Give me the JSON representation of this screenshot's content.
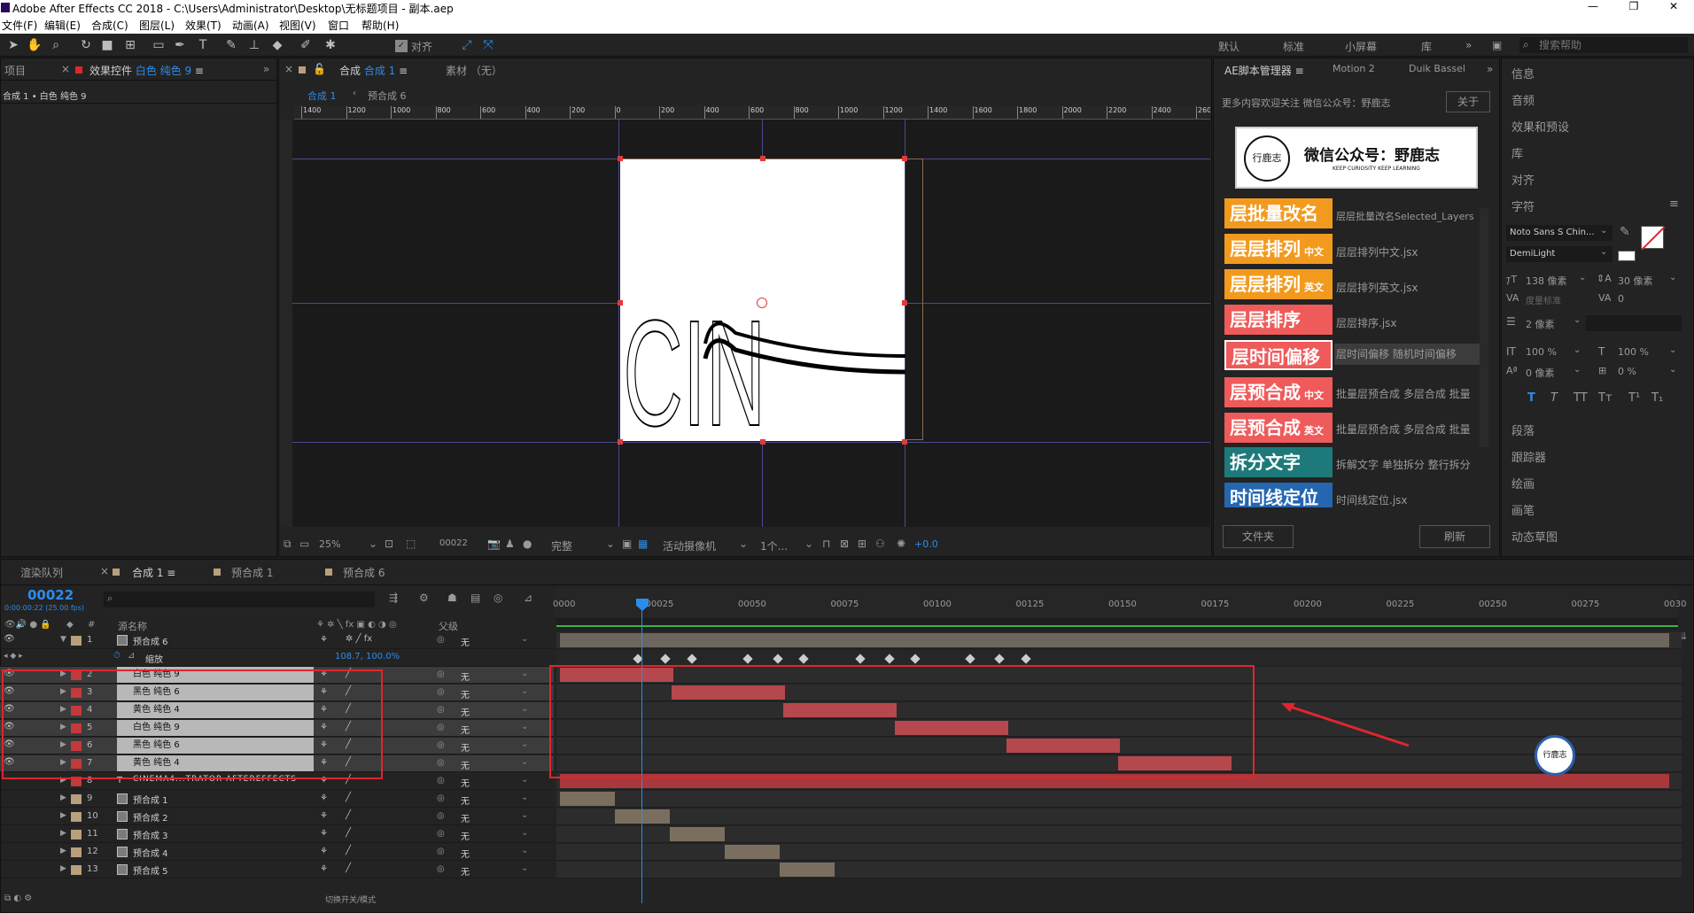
{
  "titlebar": {
    "title": "Adobe After Effects CC 2018 - C:\\Users\\Administrator\\Desktop\\无标题项目 - 副本.aep",
    "minimize": "—",
    "restore": "❐",
    "close": "✕"
  },
  "menu": [
    "文件(F)",
    "编辑(E)",
    "合成(C)",
    "图层(L)",
    "效果(T)",
    "动画(A)",
    "视图(V)",
    "窗口",
    "帮助(H)"
  ],
  "toolbar": {
    "snap_label": "对齐",
    "workspaces": [
      "默认",
      "标准",
      "小屏幕",
      "库"
    ],
    "search_placeholder": "搜索帮助"
  },
  "project_panel": {
    "tab_project": "项目",
    "tab_effects": "效果控件",
    "effects_target": "白色 纯色 9",
    "breadcrumb": "合成 1 • 白色 纯色 9"
  },
  "comp_panel": {
    "tab_label": "合成",
    "comp_name": "合成 1",
    "footage_label": "素材 （无）",
    "nav": [
      "合成 1",
      "预合成 6"
    ]
  },
  "ruler_top": [
    "1400",
    "1200",
    "1000",
    "800",
    "600",
    "400",
    "200",
    "0",
    "200",
    "400",
    "600",
    "800",
    "1000",
    "1200",
    "1400",
    "1600",
    "1800",
    "2000",
    "2200",
    "2400",
    "260"
  ],
  "viewer_text": "CIN",
  "viewer_footer": {
    "zoom": "25%",
    "timecode": "00022",
    "resolution": "完整",
    "camera": "活动摄像机",
    "views": "1个...",
    "exposure": "+0.0"
  },
  "ae_manager": {
    "tabs": [
      "AE脚本管理器",
      "Motion 2",
      "Duik Bassel"
    ],
    "notice": "更多内容欢迎关注 微信公众号：野鹿志",
    "about": "关于",
    "logo_title": "微信公众号：野鹿志",
    "logo_sub": "KEEP CURIOSITY KEEP LEARNING",
    "logo_mark": "行鹿志",
    "buttons": [
      {
        "label": "层批量改名",
        "tag": "",
        "desc": "层层批量改名Selected_Layers",
        "color": "#f29a1e"
      },
      {
        "label": "层层排列",
        "tag": "中文",
        "desc": "层层排列中文.jsx",
        "color": "#f29a1e"
      },
      {
        "label": "层层排列",
        "tag": "英文",
        "desc": "层层排列英文.jsx",
        "color": "#f29a1e"
      },
      {
        "label": "层层排序",
        "tag": "",
        "desc": "层层排序.jsx",
        "color": "#ef5a5a"
      },
      {
        "label": "层时间偏移",
        "tag": "",
        "desc": "层时间偏移 随机时间偏移",
        "color": "#ef5a5a"
      },
      {
        "label": "层预合成",
        "tag": "中文",
        "desc": "批量层预合成 多层合成 批量",
        "color": "#ef5a5a"
      },
      {
        "label": "层预合成",
        "tag": "英文",
        "desc": "批量层预合成 多层合成 批量",
        "color": "#ef5a5a"
      },
      {
        "label": "拆分文字",
        "tag": "",
        "desc": "拆解文字 单独拆分 整行拆分",
        "color": "#1e7a7a"
      },
      {
        "label": "时间线定位",
        "tag": "",
        "desc": "时间线定位.jsx",
        "color": "#2566b0"
      }
    ],
    "folder_btn": "文件夹",
    "refresh_btn": "刷新"
  },
  "right_panels": [
    "信息",
    "音频",
    "效果和预设",
    "库",
    "对齐",
    "字符",
    "段落",
    "跟踪器",
    "绘画",
    "画笔",
    "动态草图"
  ],
  "character": {
    "font": "Noto Sans S Chin...",
    "style": "DemiLight",
    "size": "138 像素",
    "leading": "30 像素",
    "kerning": "度量标准",
    "tracking": "0",
    "stroke": "2 像素",
    "v_scale": "100 %",
    "h_scale": "100 %",
    "baseline": "0 像素",
    "tsume": "0 %",
    "type_buttons": [
      "T",
      "T",
      "TT",
      "Tт",
      "T¹",
      "T₁"
    ]
  },
  "timeline": {
    "tabs": [
      "渲染队列",
      "合成 1",
      "预合成 1",
      "预合成 6"
    ],
    "timecode": "00022",
    "timecode_sub": "0:00:00:22 (25.00 fps)",
    "columns": {
      "num": "#",
      "source": "源名称",
      "parent": "父级"
    },
    "ticks": [
      "0000",
      "00025",
      "00050",
      "00075",
      "00100",
      "00125",
      "00150",
      "00175",
      "00200",
      "00225",
      "00250",
      "00275",
      "0030"
    ],
    "scale_label": "缩放",
    "scale_value": "108.7, 100.0%",
    "footer": "切换开关/模式",
    "layers": [
      {
        "num": "1",
        "name": "预合成 6",
        "color": "#b8a07a",
        "parent": "无",
        "selected": false,
        "type": "comp"
      },
      {
        "num": "2",
        "name": "白色 纯色 9",
        "color": "#ffffff",
        "parent": "无",
        "selected": true,
        "type": "solid"
      },
      {
        "num": "3",
        "name": "黑色 纯色 6",
        "color": "#000000",
        "parent": "无",
        "selected": true,
        "type": "solid"
      },
      {
        "num": "4",
        "name": "黄色 纯色 4",
        "color": "#ffee00",
        "parent": "无",
        "selected": true,
        "type": "solid"
      },
      {
        "num": "5",
        "name": "白色 纯色 9",
        "color": "#ffffff",
        "parent": "无",
        "selected": true,
        "type": "solid"
      },
      {
        "num": "6",
        "name": "黑色 纯色 6",
        "color": "#000000",
        "parent": "无",
        "selected": true,
        "type": "solid"
      },
      {
        "num": "7",
        "name": "黄色 纯色 4",
        "color": "#ffee00",
        "parent": "无",
        "selected": true,
        "type": "solid"
      },
      {
        "num": "8",
        "name": "CINEMA4...TRATOR AFTEREFFECTS",
        "color": "#c23a3a",
        "parent": "无",
        "selected": false,
        "type": "text"
      },
      {
        "num": "9",
        "name": "预合成 1",
        "color": "#b8a07a",
        "parent": "无",
        "selected": false,
        "type": "comp"
      },
      {
        "num": "10",
        "name": "预合成 2",
        "color": "#b8a07a",
        "parent": "无",
        "selected": false,
        "type": "comp"
      },
      {
        "num": "11",
        "name": "预合成 3",
        "color": "#b8a07a",
        "parent": "无",
        "selected": false,
        "type": "comp"
      },
      {
        "num": "12",
        "name": "预合成 4",
        "color": "#b8a07a",
        "parent": "无",
        "selected": false,
        "type": "comp"
      },
      {
        "num": "13",
        "name": "预合成 5",
        "color": "#b8a07a",
        "parent": "无",
        "selected": false,
        "type": "comp"
      }
    ]
  },
  "colors": {
    "accent": "#2d8ceb",
    "highlight_box": "#e0262d",
    "solid_bar": "#b5484c",
    "precomp_bar": "#7a6f5f"
  }
}
